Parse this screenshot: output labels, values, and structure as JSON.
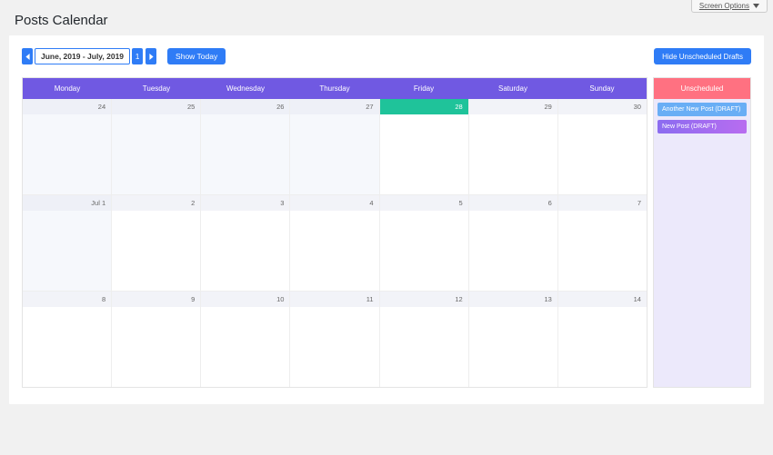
{
  "screen_options_label": "Screen Options",
  "page_title": "Posts Calendar",
  "toolbar": {
    "range_label": "June, 2019 - July, 2019",
    "one_label": "1",
    "show_today_label": "Show Today",
    "hide_drafts_label": "Hide Unscheduled Drafts"
  },
  "day_headers": [
    "Monday",
    "Tuesday",
    "Wednesday",
    "Thursday",
    "Friday",
    "Saturday",
    "Sunday"
  ],
  "weeks": [
    [
      {
        "d": "24",
        "prev": true,
        "today": false
      },
      {
        "d": "25",
        "prev": true,
        "today": false
      },
      {
        "d": "26",
        "prev": true,
        "today": false
      },
      {
        "d": "27",
        "prev": true,
        "today": false
      },
      {
        "d": "28",
        "prev": false,
        "today": true
      },
      {
        "d": "29",
        "prev": false,
        "today": false
      },
      {
        "d": "30",
        "prev": false,
        "today": false
      }
    ],
    [
      {
        "d": "Jul 1",
        "prev": true,
        "today": false
      },
      {
        "d": "2",
        "prev": false,
        "today": false
      },
      {
        "d": "3",
        "prev": false,
        "today": false
      },
      {
        "d": "4",
        "prev": false,
        "today": false
      },
      {
        "d": "5",
        "prev": false,
        "today": false
      },
      {
        "d": "6",
        "prev": false,
        "today": false
      },
      {
        "d": "7",
        "prev": false,
        "today": false
      }
    ],
    [
      {
        "d": "8",
        "prev": false,
        "today": false
      },
      {
        "d": "9",
        "prev": false,
        "today": false
      },
      {
        "d": "10",
        "prev": false,
        "today": false
      },
      {
        "d": "11",
        "prev": false,
        "today": false
      },
      {
        "d": "12",
        "prev": false,
        "today": false
      },
      {
        "d": "13",
        "prev": false,
        "today": false
      },
      {
        "d": "14",
        "prev": false,
        "today": false
      }
    ]
  ],
  "unscheduled": {
    "header": "Unscheduled",
    "drafts": [
      {
        "label": "Another New Post (DRAFT)",
        "style": "blue"
      },
      {
        "label": "New Post (DRAFT)",
        "style": "purple"
      }
    ]
  }
}
